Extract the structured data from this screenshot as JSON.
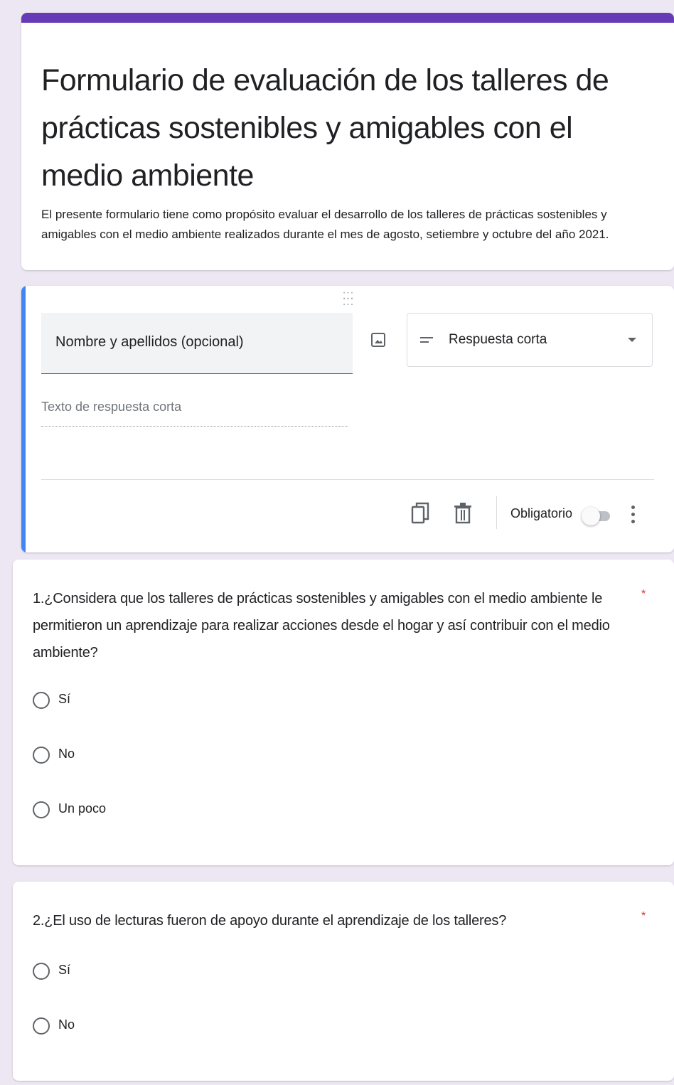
{
  "form": {
    "title": "Formulario de evaluación de los talleres de prácticas sostenibles y amigables con el medio ambiente",
    "description": "El presente formulario tiene como propósito evaluar el desarrollo de los talleres de prácticas sostenibles y amigables con el medio ambiente realizados durante el mes de agosto, setiembre y octubre del año 2021.",
    "accent_color": "#673ab7"
  },
  "editing_question": {
    "title": "Nombre y apellidos (opcional)",
    "type": "Respuesta corta",
    "answer_hint": "Texto de respuesta corta",
    "required_label": "Obligatorio",
    "required": false,
    "focus_color": "#4285f4"
  },
  "questions": [
    {
      "title": "1.¿Considera que los talleres de prácticas sostenibles y amigables con el medio ambiente le permitieron un aprendizaje para realizar acciones desde el hogar y así contribuir con el medio ambiente?",
      "required_mark": "*",
      "options": [
        "Sí",
        "No",
        "Un poco"
      ]
    },
    {
      "title": "2.¿El uso de lecturas fueron de apoyo durante el aprendizaje de los talleres?",
      "required_mark": "*",
      "options": [
        "Sí",
        "No"
      ]
    }
  ]
}
